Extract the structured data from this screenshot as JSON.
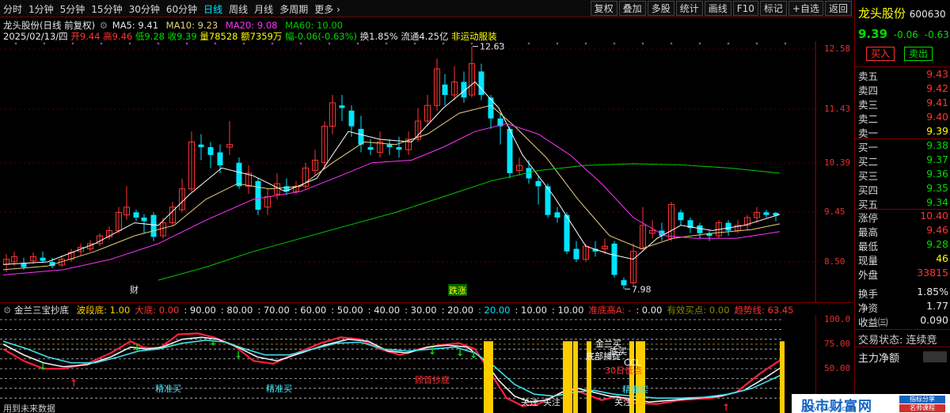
{
  "toolbar": {
    "periods": [
      "分时",
      "1分钟",
      "5分钟",
      "15分钟",
      "30分钟",
      "60分钟",
      "日线",
      "周线",
      "月线",
      "多周期",
      "更多 ›"
    ],
    "active_period": "日线",
    "actions": [
      "复权",
      "叠加",
      "多股",
      "统计",
      "画线",
      "F10",
      "标记",
      "+自选",
      "返回"
    ]
  },
  "chart_header": {
    "title": "龙头股份(日线 前复权)",
    "ma5": "MA5: 9.41",
    "ma10": "MA10: 9.23",
    "ma20": "MA20: 9.08",
    "ma60": "MA60: 10.00"
  },
  "quote_line": {
    "date": "2025/02/13/四",
    "open": "开9.44",
    "high": "高9.46",
    "low": "低9.28",
    "close": "收9.39",
    "volume": "量78528",
    "amount": "额7359万",
    "change": "幅-0.06(-0.63%)",
    "turnover": "换1.85%",
    "float": "流通4.25亿",
    "sector": "非运动服装"
  },
  "price_axis": [
    "12.58",
    "11.43",
    "10.39",
    "9.45",
    "8.50"
  ],
  "price_annotations": {
    "high": "12.63",
    "low": "7.98"
  },
  "chart_markers": {
    "finance": "财",
    "limit": "跌涨"
  },
  "indicator": {
    "name": "金兰三宝抄底",
    "items": [
      {
        "label": "波段底: 1.00",
        "color": "#ffd000"
      },
      {
        "label": "大底: 0.00",
        "color": "#ff3030"
      },
      {
        "label": ": 90.00",
        "color": "#e8e8e8"
      },
      {
        "label": ": 80.00",
        "color": "#e8e8e8"
      },
      {
        "label": ": 70.00",
        "color": "#e8e8e8"
      },
      {
        "label": ": 60.00",
        "color": "#e8e8e8"
      },
      {
        "label": ": 50.00",
        "color": "#e8e8e8"
      },
      {
        "label": ": 40.00",
        "color": "#e8e8e8"
      },
      {
        "label": ": 30.00",
        "color": "#e8e8e8"
      },
      {
        "label": ": 20.00",
        "color": "#e8e8e8"
      },
      {
        "label": ": 20.00",
        "color": "#00e5ff"
      },
      {
        "label": ": 10.00",
        "color": "#e8e8e8"
      },
      {
        "label": ": 10.00",
        "color": "#e8e8e8"
      },
      {
        "label": "准底高A: -",
        "color": "#ff3030"
      },
      {
        "label": ": 0.00",
        "color": "#e8e8e8"
      },
      {
        "label": "有效买点: 0.00",
        "color": "#8b8b00"
      },
      {
        "label": "趋势线: 63.45",
        "color": "#ff3030"
      }
    ],
    "axis": [
      "100.0",
      "75.00",
      "50.00"
    ],
    "labels": {
      "jingzhun1": "精准买",
      "jingzhun2": "精准买",
      "dichaodi": "顾首抄底",
      "guanzhu1": "关注",
      "guanzhu2": "关注",
      "guanzhu3": "关注",
      "jinglan": "金兰买",
      "dibuzhuo": "底部捕捉",
      "ccl": "CCL",
      "ma30": "30日低点",
      "jingzhun3": "精准买",
      "dimai": "底买"
    },
    "bottom_text": "用到未来数据"
  },
  "right_panel": {
    "stock_name": "龙头股份",
    "stock_code": "600630",
    "price": "9.39",
    "change": "-0.06",
    "change_pct": "-0.63",
    "buy_label": "买入",
    "sell_label": "卖出",
    "sell_orders": [
      {
        "label": "卖五",
        "price": "9.43"
      },
      {
        "label": "卖四",
        "price": "9.42"
      },
      {
        "label": "卖三",
        "price": "9.41"
      },
      {
        "label": "卖二",
        "price": "9.40"
      },
      {
        "label": "卖一",
        "price": "9.39"
      }
    ],
    "buy_orders": [
      {
        "label": "买一",
        "price": "9.38"
      },
      {
        "label": "买二",
        "price": "9.37"
      },
      {
        "label": "买三",
        "price": "9.36"
      },
      {
        "label": "买四",
        "price": "9.35"
      },
      {
        "label": "买五",
        "price": "9.34"
      }
    ],
    "stats": [
      {
        "label": "涨停",
        "value": "10.40",
        "color": "red"
      },
      {
        "label": "最高",
        "value": "9.46",
        "color": "red"
      },
      {
        "label": "最低",
        "value": "9.28",
        "color": "green"
      },
      {
        "label": "现量",
        "value": "46",
        "color": "yellow"
      },
      {
        "label": "外盘",
        "value": "33815",
        "color": "red"
      },
      {
        "label": "换手",
        "value": "1.85%",
        "color": "white"
      },
      {
        "label": "净资",
        "value": "1.77",
        "color": "white"
      },
      {
        "label": "收益㈢",
        "value": "0.090",
        "color": "white"
      }
    ],
    "trade_status": "交易状态: 连续竞",
    "main_flow": "主力净额"
  },
  "watermark": {
    "text": "股市财富网",
    "url": "WWW.GSCFW.COM",
    "tag1": "指标分享",
    "tag2": "名师课程"
  },
  "colors": {
    "up": "#ff3333",
    "down": "#00e5ff",
    "ma5": "#ffffff",
    "ma10": "#e8d080",
    "ma20": "#ff33ff",
    "ma60": "#00cc00",
    "border": "#7a0000"
  }
}
